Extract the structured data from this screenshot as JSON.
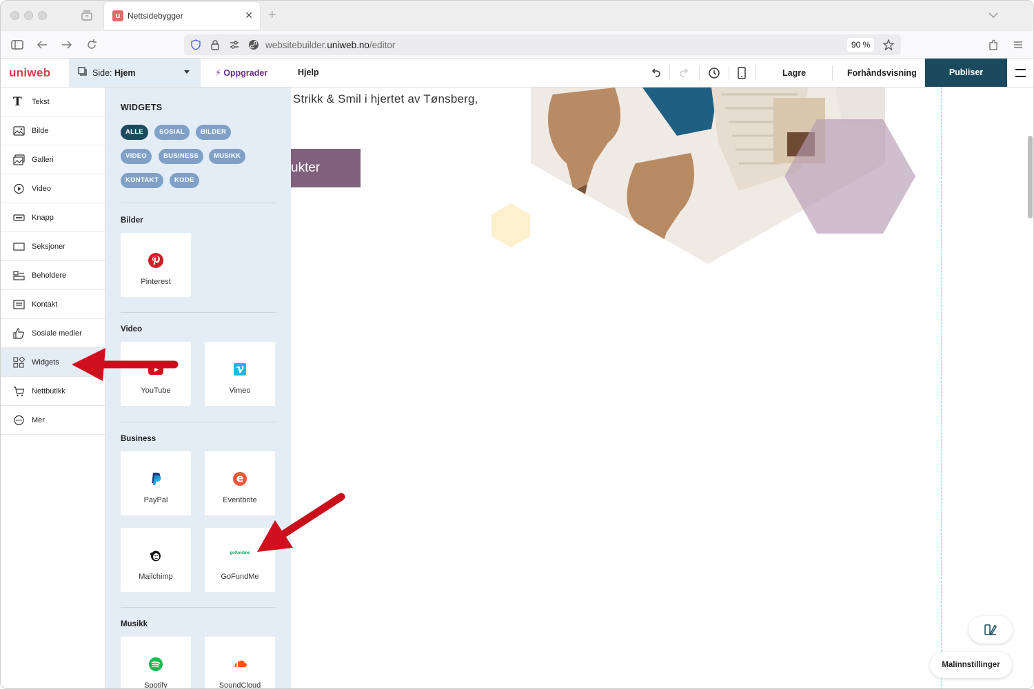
{
  "browser": {
    "tab_title": "Nettsidebygger",
    "tab_favicon_letter": "u",
    "url_prefix": "websitebuilder.",
    "url_domain": "uniweb.no",
    "url_path": "/editor",
    "zoom": "90 %"
  },
  "toolbar": {
    "logo": "uniweb",
    "page_prefix": "Side: ",
    "page_name": "Hjem",
    "upgrade": "Oppgrader",
    "help": "Hjelp",
    "save": "Lagre",
    "preview": "Forhåndsvisning",
    "publish": "Publiser"
  },
  "sidebar": {
    "items": [
      {
        "label": "Tekst",
        "icon": "text-icon"
      },
      {
        "label": "Bilde",
        "icon": "image-icon"
      },
      {
        "label": "Galleri",
        "icon": "gallery-icon"
      },
      {
        "label": "Video",
        "icon": "video-icon"
      },
      {
        "label": "Knapp",
        "icon": "button-icon"
      },
      {
        "label": "Seksjoner",
        "icon": "sections-icon"
      },
      {
        "label": "Beholdere",
        "icon": "containers-icon"
      },
      {
        "label": "Kontakt",
        "icon": "contact-icon"
      },
      {
        "label": "Sosiale medier",
        "icon": "thumbs-up-icon"
      },
      {
        "label": "Widgets",
        "icon": "widgets-icon"
      },
      {
        "label": "Nettbutikk",
        "icon": "cart-icon"
      },
      {
        "label": "Mer",
        "icon": "more-icon"
      }
    ],
    "active": "Widgets"
  },
  "panel": {
    "title": "WIDGETS",
    "chips": [
      "ALLE",
      "SOSIAL",
      "BILDER",
      "VIDEO",
      "BUSINESS",
      "MUSIKK",
      "KONTAKT",
      "KODE"
    ],
    "active_chip": "ALLE",
    "sections": [
      {
        "title": "Bilder",
        "items": [
          "Pinterest"
        ]
      },
      {
        "title": "Video",
        "items": [
          "YouTube",
          "Vimeo"
        ]
      },
      {
        "title": "Business",
        "items": [
          "PayPal",
          "Eventbrite",
          "Mailchimp",
          "GoFundMe"
        ]
      },
      {
        "title": "Musikk",
        "items": [
          "Spotify",
          "SoundCloud"
        ]
      }
    ],
    "gofundme_logo_text": "gofundme"
  },
  "canvas": {
    "hero_text": "Strikk & Smil i hjertet av Tønsberg,",
    "cta_text": "ukter",
    "template_settings": "Malinnstillinger"
  },
  "colors": {
    "accent": "#1b4a5e",
    "brand": "#d43b4e",
    "chip": "#7fa1c8",
    "panel_bg": "#e4edf6",
    "cta": "#80607d",
    "arrow": "#d0101f"
  }
}
